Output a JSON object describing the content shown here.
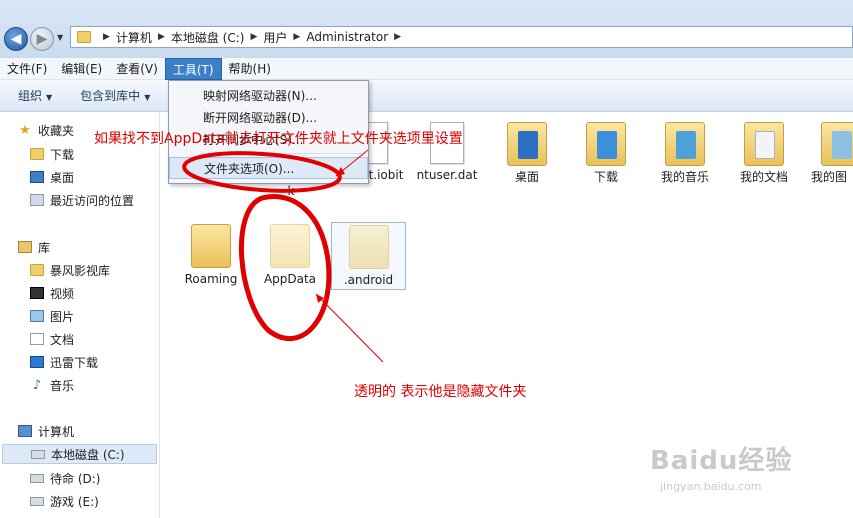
{
  "address": {
    "breadcrumbs": [
      "计算机",
      "本地磁盘 (C:)",
      "用户",
      "Administrator"
    ]
  },
  "menu": {
    "items": [
      "文件(F)",
      "编辑(E)",
      "查看(V)",
      "工具(T)",
      "帮助(H)"
    ],
    "active_index": 3
  },
  "toolbar": {
    "organize": "组织",
    "include_library": "包含到库中"
  },
  "dropdown": {
    "items": [
      "映射网络驱动器(N)...",
      "断开网络驱动器(D)...",
      "打开同步中心(S)...",
      "文件夹选项(O)..."
    ],
    "highlighted_index": 3
  },
  "sidebar": {
    "favorites_header": "收藏夹",
    "favorites": [
      "下载",
      "桌面",
      "最近访问的位置"
    ],
    "library_header": "库",
    "libraries": [
      "暴风影视库",
      "视频",
      "图片",
      "文档",
      "迅雷下载",
      "音乐"
    ],
    "computer_header": "计算机",
    "drives": [
      "本地磁盘 (C:)",
      "待命 (D:)",
      "游戏 (E:)"
    ]
  },
  "content": {
    "row1": [
      "er.dat.iobit",
      "ntuser.dat",
      "桌面",
      "下载",
      "我的音乐",
      "我的文档",
      "我的图"
    ],
    "iodefrag": "iodefrag.bak",
    "row2": [
      "Roaming",
      "AppData",
      ".android"
    ]
  },
  "annotations": {
    "top": "如果找不到AppData就去打开文件夹就上文件夹选项里设置",
    "bottom": "透明的  表示他是隐藏文件夹"
  },
  "watermark": {
    "brand": "Baidu经验",
    "url": "jingyan.baidu.com"
  },
  "colors": {
    "accent": "#3b80c6",
    "annotation": "#e00000"
  }
}
